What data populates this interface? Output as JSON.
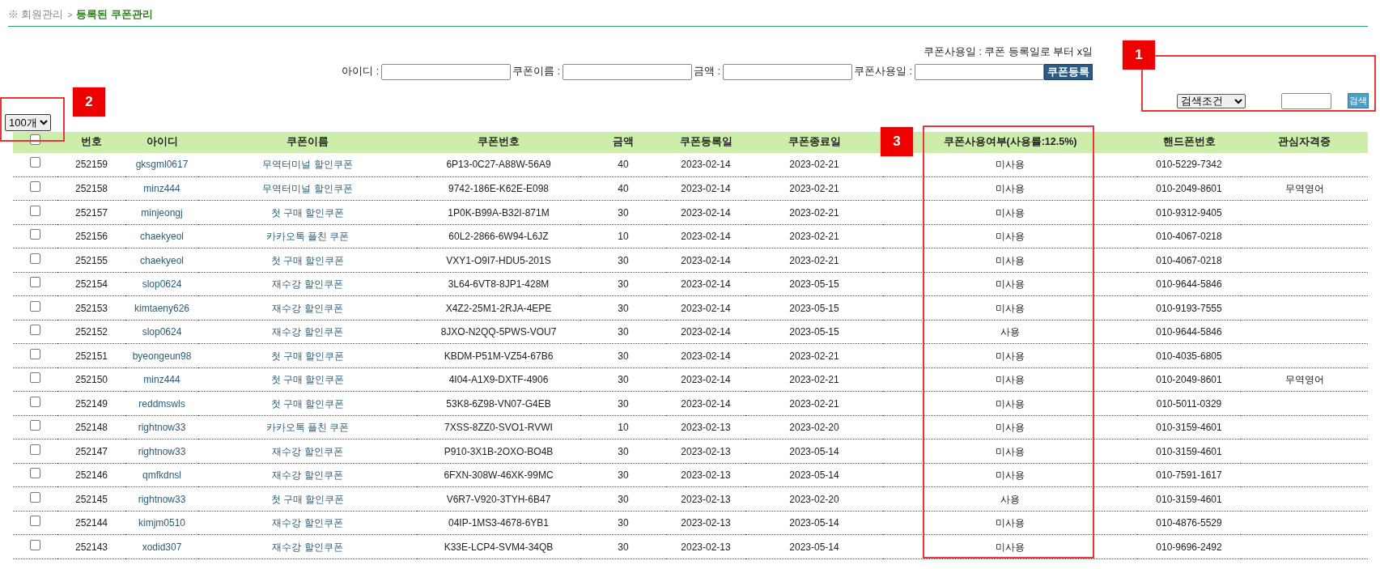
{
  "breadcrumb": {
    "parent": "※ 회원관리",
    "separator": ">",
    "current": "등록된 쿠폰관리"
  },
  "note": "쿠폰사용일 : 쿠폰 등록일로 부터 x일",
  "form": {
    "fields": [
      {
        "label": "아이디 :"
      },
      {
        "label": "쿠폰이름 :"
      },
      {
        "label": "금액 :"
      },
      {
        "label": "쿠폰사용일 :"
      }
    ],
    "button": "쿠폰등록"
  },
  "search": {
    "condition": "검색조건",
    "button": "검색"
  },
  "page_size": "100개",
  "table": {
    "select_all": {
      "checked": false
    },
    "columns": [
      "번호",
      "아이디",
      "쿠폰이름",
      "쿠폰번호",
      "금액",
      "쿠폰등록일",
      "쿠폰종료일",
      "쿠폰사용여부(사용률:12.5%)",
      "핸드폰번호",
      "관심자격증"
    ],
    "rows": [
      {
        "checked": false,
        "number": "252159",
        "id": "gksgml0617",
        "coupon_name": "무역터미널 할인쿠폰",
        "coupon_code": "6P13-0C27-A88W-56A9",
        "amount": "40",
        "issued": "2023-02-14",
        "expires": "2023-02-21",
        "usage": "미사용",
        "phone": "010-5229-7342"
      },
      {
        "checked": false,
        "number": "252158",
        "id": "minz444",
        "coupon_name": "무역터미널 할인쿠폰",
        "coupon_code": "9742-186E-K62E-E098",
        "amount": "40",
        "issued": "2023-02-14",
        "expires": "2023-02-21",
        "usage": "미사용",
        "phone": "010-2049-8601",
        "interest": "무역영어"
      },
      {
        "checked": false,
        "number": "252157",
        "id": "minjeongj",
        "coupon_name": "첫 구매 할인쿠폰",
        "coupon_code": "1P0K-B99A-B32I-871M",
        "amount": "30",
        "issued": "2023-02-14",
        "expires": "2023-02-21",
        "usage": "미사용",
        "phone": "010-9312-9405"
      },
      {
        "checked": false,
        "number": "252156",
        "id": "chaekyeol",
        "coupon_name": "카카오톡 플친 쿠폰",
        "coupon_code": "60L2-2866-6W94-L6JZ",
        "amount": "10",
        "issued": "2023-02-14",
        "expires": "2023-02-21",
        "usage": "미사용",
        "phone": "010-4067-0218"
      },
      {
        "checked": false,
        "number": "252155",
        "id": "chaekyeol",
        "coupon_name": "첫 구매 할인쿠폰",
        "coupon_code": "VXY1-O9I7-HDU5-201S",
        "amount": "30",
        "issued": "2023-02-14",
        "expires": "2023-02-21",
        "usage": "미사용",
        "phone": "010-4067-0218"
      },
      {
        "checked": false,
        "number": "252154",
        "id": "slop0624",
        "coupon_name": "재수강 할인쿠폰",
        "coupon_code": "3L64-6VT8-8JP1-428M",
        "amount": "30",
        "issued": "2023-02-14",
        "expires": "2023-05-15",
        "usage": "미사용",
        "phone": "010-9644-5846"
      },
      {
        "checked": false,
        "number": "252153",
        "id": "kimtaeny626",
        "coupon_name": "재수강 할인쿠폰",
        "coupon_code": "X4Z2-25M1-2RJA-4EPE",
        "amount": "30",
        "issued": "2023-02-14",
        "expires": "2023-05-15",
        "usage": "미사용",
        "phone": "010-9193-7555"
      },
      {
        "checked": false,
        "number": "252152",
        "id": "slop0624",
        "coupon_name": "재수강 할인쿠폰",
        "coupon_code": "8JXO-N2QQ-5PWS-VOU7",
        "amount": "30",
        "issued": "2023-02-14",
        "expires": "2023-05-15",
        "usage": "사용",
        "phone": "010-9644-5846"
      },
      {
        "checked": false,
        "number": "252151",
        "id": "byeongeun98",
        "coupon_name": "첫 구매 할인쿠폰",
        "coupon_code": "KBDM-P51M-VZ54-67B6",
        "amount": "30",
        "issued": "2023-02-14",
        "expires": "2023-02-21",
        "usage": "미사용",
        "phone": "010-4035-6805"
      },
      {
        "checked": false,
        "number": "252150",
        "id": "minz444",
        "coupon_name": "첫 구매 할인쿠폰",
        "coupon_code": "4I04-A1X9-DXTF-4906",
        "amount": "30",
        "issued": "2023-02-14",
        "expires": "2023-02-21",
        "usage": "미사용",
        "phone": "010-2049-8601",
        "interest": "무역영어"
      },
      {
        "checked": false,
        "number": "252149",
        "id": "reddmswls",
        "coupon_name": "첫 구매 할인쿠폰",
        "coupon_code": "53K8-6Z98-VN07-G4EB",
        "amount": "30",
        "issued": "2023-02-14",
        "expires": "2023-02-21",
        "usage": "미사용",
        "phone": "010-5011-0329"
      },
      {
        "checked": false,
        "number": "252148",
        "id": "rightnow33",
        "coupon_name": "카카오톡 플친 쿠폰",
        "coupon_code": "7XSS-8ZZ0-SVO1-RVWI",
        "amount": "10",
        "issued": "2023-02-13",
        "expires": "2023-02-20",
        "usage": "미사용",
        "phone": "010-3159-4601"
      },
      {
        "checked": false,
        "number": "252147",
        "id": "rightnow33",
        "coupon_name": "재수강 할인쿠폰",
        "coupon_code": "P910-3X1B-2OXO-BO4B",
        "amount": "30",
        "issued": "2023-02-13",
        "expires": "2023-05-14",
        "usage": "미사용",
        "phone": "010-3159-4601"
      },
      {
        "checked": false,
        "number": "252146",
        "id": "qmfkdnsl",
        "coupon_name": "재수강 할인쿠폰",
        "coupon_code": "6FXN-308W-46XK-99MC",
        "amount": "30",
        "issued": "2023-02-13",
        "expires": "2023-05-14",
        "usage": "미사용",
        "phone": "010-7591-1617"
      },
      {
        "checked": false,
        "number": "252145",
        "id": "rightnow33",
        "coupon_name": "첫 구매 할인쿠폰",
        "coupon_code": "V6R7-V920-3TYH-6B47",
        "amount": "30",
        "issued": "2023-02-13",
        "expires": "2023-02-20",
        "usage": "사용",
        "phone": "010-3159-4601"
      },
      {
        "checked": false,
        "number": "252144",
        "id": "kimjm0510",
        "coupon_name": "재수강 할인쿠폰",
        "coupon_code": "04IP-1MS3-4678-6YB1",
        "amount": "30",
        "issued": "2023-02-13",
        "expires": "2023-05-14",
        "usage": "미사용",
        "phone": "010-4876-5529"
      },
      {
        "checked": false,
        "number": "252143",
        "id": "xodid307",
        "coupon_name": "재수강 할인쿠폰",
        "coupon_code": "K33E-LCP4-SVM4-34QB",
        "amount": "30",
        "issued": "2023-02-13",
        "expires": "2023-05-14",
        "usage": "미사용",
        "phone": "010-9696-2492"
      }
    ]
  },
  "annotations": [
    {
      "label": "1"
    },
    {
      "label": "2"
    },
    {
      "label": "3"
    }
  ]
}
